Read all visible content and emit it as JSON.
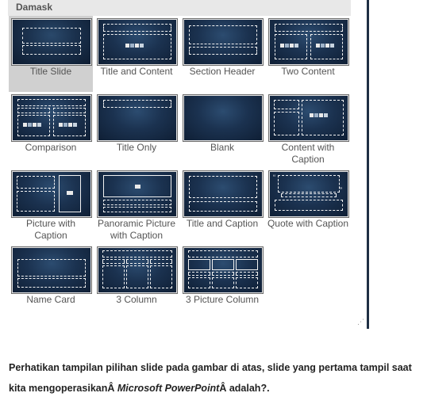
{
  "gallery": {
    "section_title": "Damask",
    "grip_icon": "resize-grip-icon",
    "layouts": [
      {
        "label": "Title Slide",
        "selected": true
      },
      {
        "label": "Title and Content",
        "selected": false
      },
      {
        "label": "Section Header",
        "selected": false
      },
      {
        "label": "Two Content",
        "selected": false
      },
      {
        "label": "Comparison",
        "selected": false
      },
      {
        "label": "Title Only",
        "selected": false
      },
      {
        "label": "Blank",
        "selected": false
      },
      {
        "label": "Content with Caption",
        "selected": false
      },
      {
        "label": "Picture with Caption",
        "selected": false
      },
      {
        "label": "Panoramic Picture with Caption",
        "selected": false
      },
      {
        "label": "Title and Caption",
        "selected": false
      },
      {
        "label": "Quote with Caption",
        "selected": false
      },
      {
        "label": "Name Card",
        "selected": false
      },
      {
        "label": "3 Column",
        "selected": false
      },
      {
        "label": "3 Picture Column",
        "selected": false
      }
    ]
  },
  "question": {
    "part1": "Perhatikan tampilan pilihan slide pada gambar di atas, slide yang pertama tampil saat kita mengoperasikanÂ ",
    "app_name": "Microsoft PowerPoint",
    "part2": "Â adalah?."
  },
  "colors": {
    "thumb_bg": "#1b3250",
    "selected_bg": "#d0d0d0",
    "header_bg": "#e8e8e8"
  }
}
